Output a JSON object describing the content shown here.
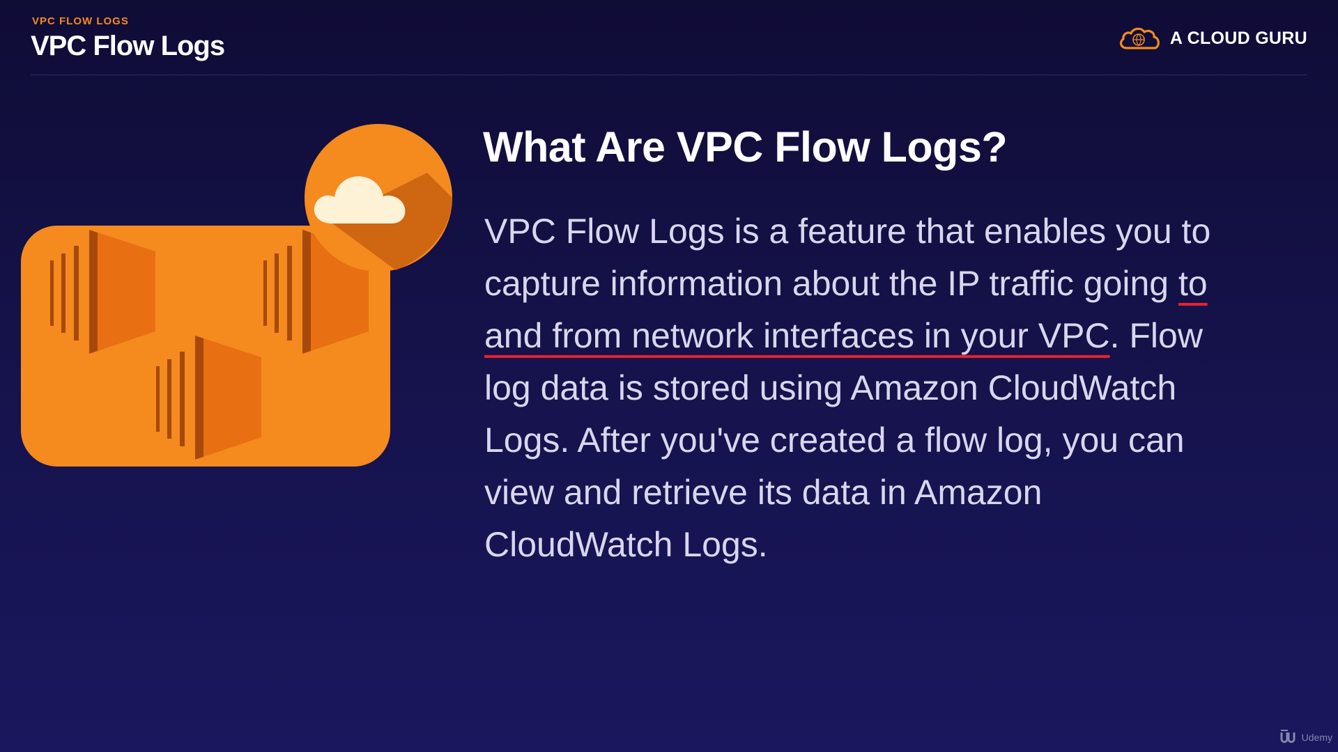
{
  "header": {
    "kicker": "VPC FLOW LOGS",
    "title": "VPC Flow Logs",
    "brand": "A CLOUD GURU"
  },
  "content": {
    "heading": "What Are VPC Flow Logs?",
    "lines": {
      "l1": "VPC Flow Logs is a feature that enables you to",
      "l2_a": "capture information about the IP traffic going ",
      "l2_b": "to",
      "l3_a": "and from network interfaces in your VPC",
      "l3_b": ". Flow",
      "l4": "log data is stored using Amazon CloudWatch",
      "l5": "Logs. After you've created a flow log, you can",
      "l6": "view and retrieve its data in Amazon",
      "l7": "CloudWatch Logs."
    },
    "highlight_color": "#e8202f"
  },
  "illustration": {
    "icon": "aws-flow-logs-icon",
    "colors": {
      "primary": "#f58a1f",
      "shade": "#c75f10",
      "bar": "#a6490c",
      "cloud": "#fdf1d6"
    }
  },
  "watermark": {
    "text": "Udemy",
    "icon": "udemy-logo-icon"
  },
  "colors": {
    "background": "#15124a",
    "accent": "#f58a1f",
    "title": "#ffffff",
    "body_text": "#d8d7ee"
  }
}
